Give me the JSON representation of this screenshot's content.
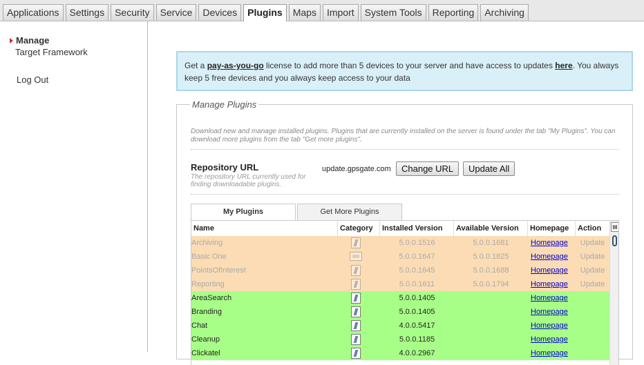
{
  "tabs": [
    "Applications",
    "Settings",
    "Security",
    "Service",
    "Devices",
    "Plugins",
    "Maps",
    "Import",
    "System Tools",
    "Reporting",
    "Archiving"
  ],
  "active_tab": "Plugins",
  "sidebar": {
    "manage": "Manage",
    "target_framework": "Target Framework",
    "logout": "Log Out"
  },
  "info": {
    "pre": "Get a ",
    "link1": "pay-as-you-go",
    "mid": " license to add more than 5 devices to your server and have access to updates ",
    "link2": "here",
    "post": ". You always keep 5 free devices and you always keep access to your data"
  },
  "manage": {
    "legend": "Manage Plugins",
    "description": "Download new and manage installed plugins. Plugins that are currently installed on the server is found under the tab \"My Plugins\". You can download more plugins from the tab \"Get more plugins\".",
    "repo_title": "Repository URL",
    "repo_desc": "The repository URL currently used for finding downloadable plugins.",
    "repo_url": "update.gpsgate.com",
    "change_url": "Change URL",
    "update_all": "Update All",
    "tab_my": "My Plugins",
    "tab_get": "Get More Plugins"
  },
  "table": {
    "headers": [
      "Name",
      "Category",
      "Installed Version",
      "Available Version",
      "Homepage",
      "Action"
    ],
    "homepage_label": "Homepage",
    "rows": [
      {
        "name": "Archiving",
        "installed": "5.0.0.1516",
        "available": "5.0.0.1681",
        "action": "Update",
        "state": "dis",
        "icon": "plugin"
      },
      {
        "name": "Basic One",
        "installed": "5.0.0.1647",
        "available": "5.0.0.1825",
        "action": "Update",
        "state": "dis",
        "icon": "monitor"
      },
      {
        "name": "PointsOfInterest",
        "installed": "5.0.0.1645",
        "available": "5.0.0.1688",
        "action": "Update",
        "state": "dis",
        "icon": "plugin"
      },
      {
        "name": "Reporting",
        "installed": "5.0.0.1611",
        "available": "5.0.0.1794",
        "action": "Update",
        "state": "dis",
        "icon": "plugin"
      },
      {
        "name": "AreaSearch",
        "installed": "5.0.0.1405",
        "available": "",
        "action": "",
        "state": "en",
        "icon": "plugin"
      },
      {
        "name": "Branding",
        "installed": "5.0.0.1405",
        "available": "",
        "action": "",
        "state": "en",
        "icon": "plugin"
      },
      {
        "name": "Chat",
        "installed": "4.0.0.5417",
        "available": "",
        "action": "",
        "state": "en",
        "icon": "plugin"
      },
      {
        "name": "Cleanup",
        "installed": "5.0.0.1185",
        "available": "",
        "action": "",
        "state": "en",
        "icon": "plugin"
      },
      {
        "name": "Clickatel",
        "installed": "4.0.0.2967",
        "available": "",
        "action": "",
        "state": "en",
        "icon": "gear"
      }
    ]
  }
}
